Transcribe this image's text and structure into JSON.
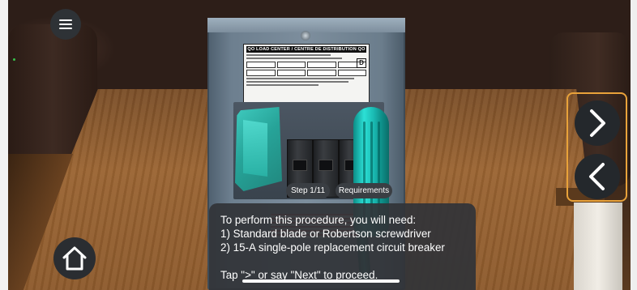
{
  "panel_label": {
    "title": "QO LOAD CENTER / CENTRE DE DISTRIBUTION QO",
    "brand_mark": "D"
  },
  "toolbar": {
    "menu_icon": "hamburger-menu-icon",
    "home_icon": "home-icon"
  },
  "navigation": {
    "next_icon": "chevron-right-icon",
    "prev_icon": "chevron-left-icon",
    "highlight_color": "#e9a23a"
  },
  "step_pill": {
    "label": "Step 1/11"
  },
  "requirements_pill": {
    "label": "Requirements"
  },
  "instructions": {
    "line1": "To perform this procedure, you will need:",
    "line2": "1) Standard blade or Robertson screwdriver",
    "line3": "2) 15-A single-pole replacement circuit breaker",
    "line4": "Tap \">\" or say \"Next\" to proceed."
  },
  "colors": {
    "ar_model": "#2bb8ab",
    "overlay": "#323438"
  }
}
